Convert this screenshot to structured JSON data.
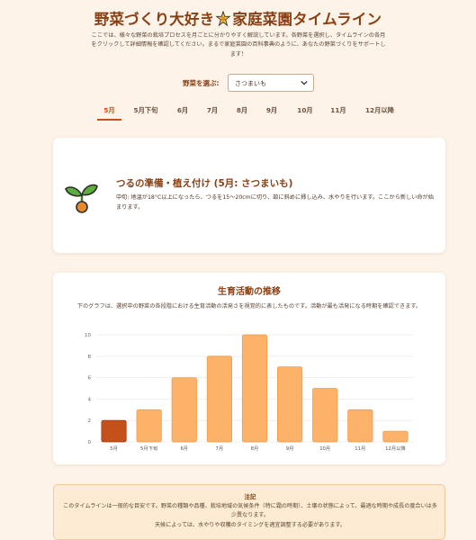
{
  "header": {
    "title_part1": "野菜づくり大好き",
    "title_part2": "家庭菜園タイムライン",
    "intro": "ここでは、様々な野菜の栽培プロセスを月ごとに分かりやすく解説しています。各野菜を選択し、タイムラインの各月をクリックして詳細情報を確認してください。まるで家庭菜園の百科事典のように、あなたの野菜づくりをサポートします！"
  },
  "selector": {
    "label": "野菜を選ぶ:",
    "selected": "さつまいも"
  },
  "tabs": [
    "5月",
    "5月下旬",
    "6月",
    "7月",
    "8月",
    "9月",
    "10月",
    "11月",
    "12月以降"
  ],
  "active_tab": "5月",
  "info": {
    "title": "つるの準備・植え付け (5月: さつまいも)",
    "body": "中旬: 地温が18°C以上になったら、つるを15〜20cmに切り、畝に斜めに挿し込み、水やりを行います。ここから新しい命が始まります。"
  },
  "chart_section": {
    "title": "生育活動の推移",
    "description": "下のグラフは、選択中の野菜の各段階における生育活動の活発さを視覚的に表したものです。活動が最も活発になる時期を確認できます。"
  },
  "chart_data": {
    "type": "bar",
    "categories": [
      "5月",
      "5月下旬",
      "6月",
      "7月",
      "8月",
      "9月",
      "10月",
      "11月",
      "12月以降"
    ],
    "values": [
      2,
      3,
      6,
      8,
      10,
      7,
      5,
      3,
      1
    ],
    "ylim": [
      0,
      10
    ],
    "yticks": [
      0,
      2,
      4,
      6,
      8,
      10
    ],
    "highlight_index": 0,
    "colors": {
      "bar": "#fdb26a",
      "bar_border": "#f49a45",
      "highlight": "#c4501a",
      "highlight_border": "#a63e10"
    },
    "grid": true
  },
  "note": {
    "title": "注記",
    "body1": "このタイムラインは一般的な目安です。野菜の種類や品種、栽培地域の気候条件（特に霜の時期）、土壌の状態によって、最適な時期や成長の度合いは多少異なります。",
    "body2": "天候によっては、水やりや収穫のタイミングを適宜調整する必要があります。"
  },
  "colors": {
    "accent": "#c4501a",
    "heading": "#8a3f12",
    "background": "#fdf3e8"
  },
  "icons": {
    "sparkle": "sparkle-icon",
    "sprout": "sprout-icon",
    "chevron": "chevron-down-icon"
  }
}
